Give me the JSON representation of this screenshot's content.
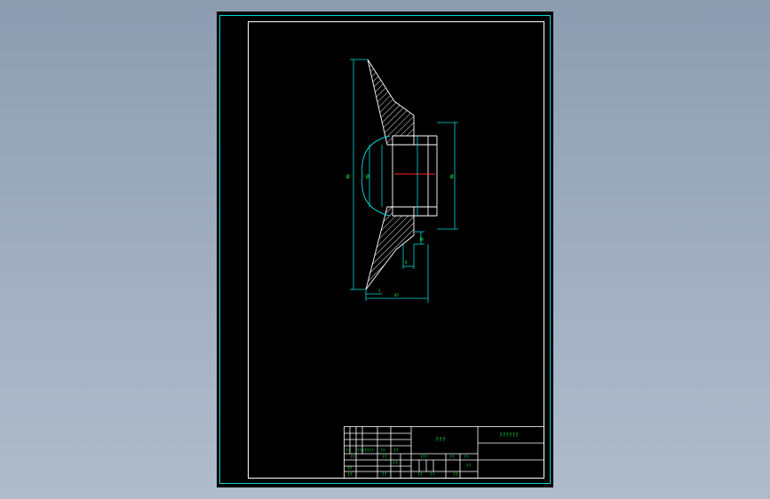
{
  "colors": {
    "background": "#9aa8bb",
    "sheet": "#000000",
    "frame": "#00d8d8",
    "lines": "#ffffff",
    "dimensions": "#00e0e0",
    "text": "#00ff3c",
    "centerline": "#ff2020",
    "hatch": "#ffffff"
  },
  "title_block": {
    "part_name": "???",
    "drawing_number": "??????",
    "small_labels": [
      "??",
      "???",
      "????",
      "??",
      "??",
      "??",
      "??",
      "??",
      "??",
      "???",
      "??",
      "??",
      "??",
      "??",
      "??",
      "??",
      "??",
      "??"
    ]
  },
  "dimensions": {
    "outer_diameter": "Ø",
    "bore_left": "Ø",
    "bore_right": "Ø",
    "small_height": "10",
    "lower_height": "8",
    "overall_width": "45",
    "offset": "1"
  }
}
